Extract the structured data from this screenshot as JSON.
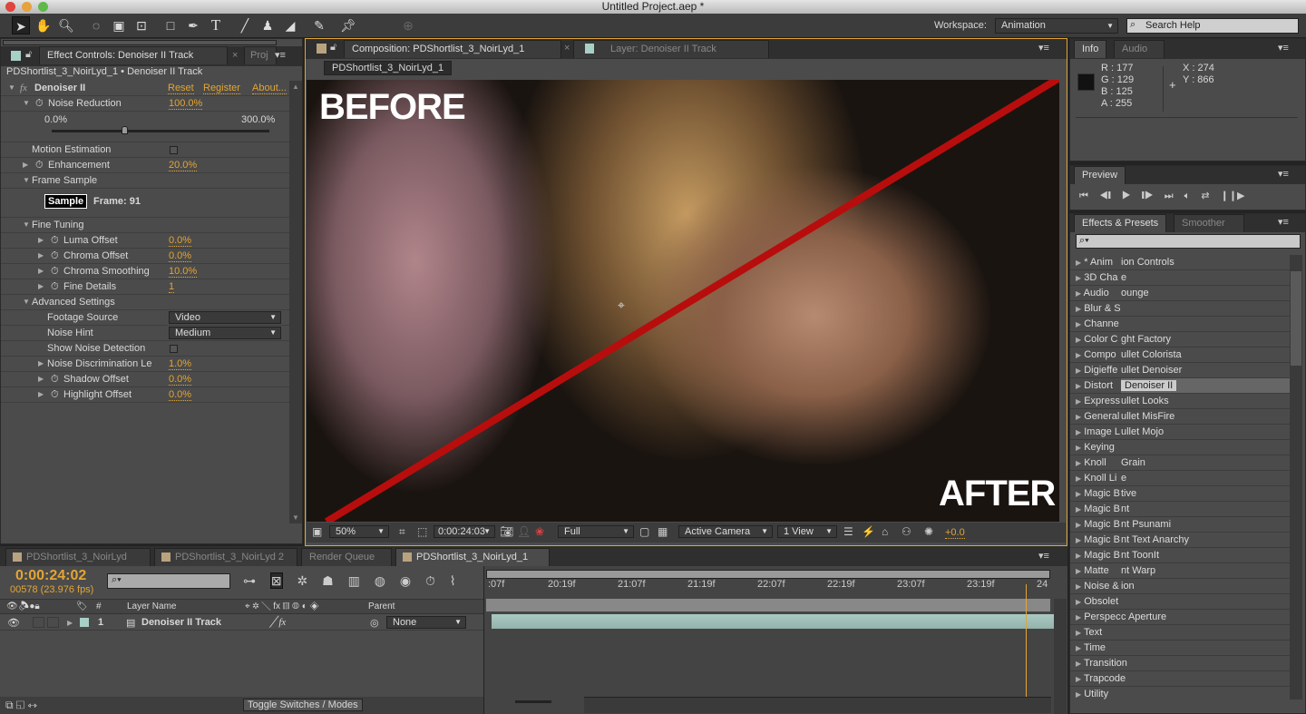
{
  "window": {
    "title": "Untitled Project.aep *"
  },
  "toolbar": {
    "workspace_label": "Workspace:",
    "workspace_value": "Animation",
    "search_placeholder": "Search Help"
  },
  "effect_controls": {
    "tab_label": "Effect Controls: Denoiser II Track",
    "tab2_label": "Proj",
    "subtitle": "PDShortlist_3_NoirLyd_1 • Denoiser II Track",
    "effect_name": "Denoiser II",
    "reset": "Reset",
    "register": "Register",
    "about": "About...",
    "noise_reduction": {
      "label": "Noise Reduction",
      "value": "100.0%",
      "min": "0.0%",
      "max": "300.0%",
      "slider_fraction": 0.333
    },
    "motion_estimation": {
      "label": "Motion Estimation",
      "checked": false
    },
    "enhancement": {
      "label": "Enhancement",
      "value": "20.0%"
    },
    "frame_sample": {
      "label": "Frame Sample",
      "button": "Sample",
      "frame": "Frame: 91"
    },
    "fine_tuning": {
      "label": "Fine Tuning",
      "items": [
        {
          "label": "Luma Offset",
          "value": "0.0%"
        },
        {
          "label": "Chroma Offset",
          "value": "0.0%"
        },
        {
          "label": "Chroma Smoothing",
          "value": "10.0%"
        },
        {
          "label": "Fine Details",
          "value": "1"
        }
      ]
    },
    "advanced": {
      "label": "Advanced Settings",
      "footage_source": {
        "label": "Footage Source",
        "value": "Video"
      },
      "noise_hint": {
        "label": "Noise Hint",
        "value": "Medium"
      },
      "show_noise": {
        "label": "Show Noise Detection",
        "checked": false
      },
      "items": [
        {
          "label": "Noise Discrimination Le",
          "value": "1.0%"
        },
        {
          "label": "Shadow Offset",
          "value": "0.0%"
        },
        {
          "label": "Highlight Offset",
          "value": "0.0%"
        }
      ]
    }
  },
  "composition": {
    "tab_label": "Composition: PDShortlist_3_NoirLyd_1",
    "layer_tab": "Layer: Denoiser II Track",
    "comp_name": "PDShortlist_3_NoirLyd_1",
    "overlay_before": "BEFORE",
    "overlay_after": "AFTER",
    "zoom": "50%",
    "timecode": "0:00:24:03",
    "resolution": "Full",
    "camera": "Active Camera",
    "views": "1 View",
    "exposure": "+0.0",
    "divider_color": "#b80d0d"
  },
  "info": {
    "tab": "Info",
    "tab2": "Audio",
    "r": "R : 177",
    "g": "G : 129",
    "b": "B : 125",
    "a": "A : 255",
    "x": "X : 274",
    "y": "Y : 866"
  },
  "preview": {
    "tab": "Preview"
  },
  "effects_presets": {
    "tab": "Effects & Presets",
    "tab2": "Smoother",
    "categories": [
      "* Anim",
      "3D Cha",
      "Audio",
      "Blur & S",
      "Channe",
      "Color C",
      "Compo",
      "Digieffe",
      "Distort",
      "Express",
      "General",
      "Image L",
      "Keying",
      "Knoll",
      "Knoll Li",
      "Magic B",
      "Magic B",
      "Magic B",
      "Magic B",
      "Magic B",
      "Matte",
      "Noise &",
      "Obsolet",
      "Perspec",
      "Text",
      "Time",
      "Transition",
      "Trapcode",
      "Utility"
    ],
    "overlay_items": [
      "ion Controls",
      "e",
      "ounge",
      "",
      "",
      "ght Factory",
      "ullet Colorista",
      "ullet Denoiser",
      "Denoiser II",
      "ullet Looks",
      "ullet MisFire",
      "ullet Mojo",
      "",
      "Grain",
      "e",
      "tive",
      "nt",
      "nt Psunami",
      "nt Text Anarchy",
      "nt ToonIt",
      "nt Warp",
      "ion",
      "",
      "c Aperture"
    ]
  },
  "timeline": {
    "tabs": [
      "PDShortlist_3_NoirLyd",
      "PDShortlist_3_NoirLyd 2",
      "Render Queue",
      "PDShortlist_3_NoirLyd_1"
    ],
    "timecode": "0:00:24:02",
    "frame_info": "00578 (23.976 fps)",
    "columns": {
      "num": "#",
      "layer_name": "Layer Name",
      "parent": "Parent"
    },
    "layer": {
      "num": "1",
      "name": "Denoiser II Track",
      "parent": "None"
    },
    "ruler": [
      ":07f",
      "20:19f",
      "21:07f",
      "21:19f",
      "22:07f",
      "22:19f",
      "23:07f",
      "23:19f",
      "24"
    ],
    "toggle": "Toggle Switches / Modes"
  }
}
